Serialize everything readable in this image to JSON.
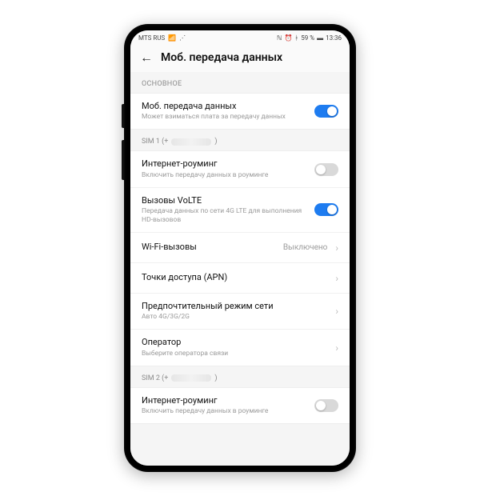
{
  "statusbar": {
    "carrier": "MTS RUS",
    "battery": "59 %",
    "time": "13:36"
  },
  "header": {
    "title": "Моб. передача данных"
  },
  "sections": {
    "main_label": "ОСНОВНОЕ",
    "sim1_label": "SIM 1 (+",
    "sim1_close": ")",
    "sim2_label": "SIM 2 (+",
    "sim2_close": ")"
  },
  "rows": {
    "mobile_data": {
      "title": "Моб. передача данных",
      "sub": "Может взиматься плата за передачу данных"
    },
    "roaming1": {
      "title": "Интернет-роуминг",
      "sub": "Включить передачу данных в роуминге"
    },
    "volte": {
      "title": "Вызовы VoLTE",
      "sub": "Передача данных по сети 4G LTE для выполнения HD-вызовов"
    },
    "wifi_call": {
      "title": "Wi-Fi-вызовы",
      "value": "Выключено"
    },
    "apn": {
      "title": "Точки доступа (APN)"
    },
    "net_mode": {
      "title": "Предпочтительный режим сети",
      "sub": "Авто 4G/3G/2G"
    },
    "operator": {
      "title": "Оператор",
      "sub": "Выберите оператора связи"
    },
    "roaming2": {
      "title": "Интернет-роуминг",
      "sub": "Включить передачу данных в роуминге"
    }
  },
  "colors": {
    "accent": "#1e7cf0"
  }
}
